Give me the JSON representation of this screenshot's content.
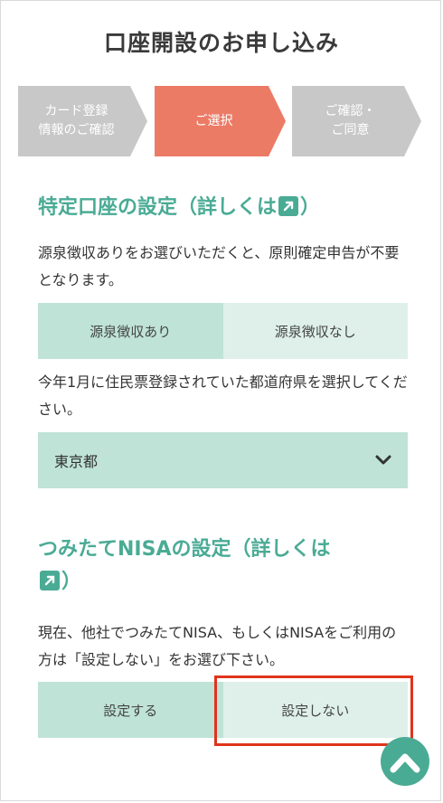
{
  "page": {
    "title": "口座開設のお申し込み"
  },
  "steps": [
    {
      "line1": "カード登録",
      "line2": "情報のご確認"
    },
    {
      "line1": "ご選択",
      "line2": ""
    },
    {
      "line1": "ご確認・",
      "line2": "ご同意"
    }
  ],
  "tokutei": {
    "title": "特定口座の設定（詳しくは",
    "title_end": "）",
    "desc": "源泉徴収ありをお選びいただくと、原則確定申告が不要となります。",
    "option_yes": "源泉徴収あり",
    "option_no": "源泉徴収なし",
    "pref_desc": "今年1月に住民票登録されていた都道府県を選択してください。",
    "pref_selected": "東京都"
  },
  "nisa": {
    "title": "つみたてNISAの設定（詳しくは",
    "title_end": "）",
    "desc": "現在、他社でつみたてNISA、もしくはNISAをご利用の方は「設定しない」をお選び下さい。",
    "option_yes": "設定する",
    "option_no": "設定しない"
  },
  "colors": {
    "accent": "#4aab95",
    "active_step": "#ec7b66",
    "inactive_step": "#c8c8c8",
    "highlight": "#e0341c"
  },
  "icons": {
    "external_link": "external-link-icon",
    "dropdown": "chevron-down-icon",
    "scroll_top": "chevron-up-icon"
  }
}
